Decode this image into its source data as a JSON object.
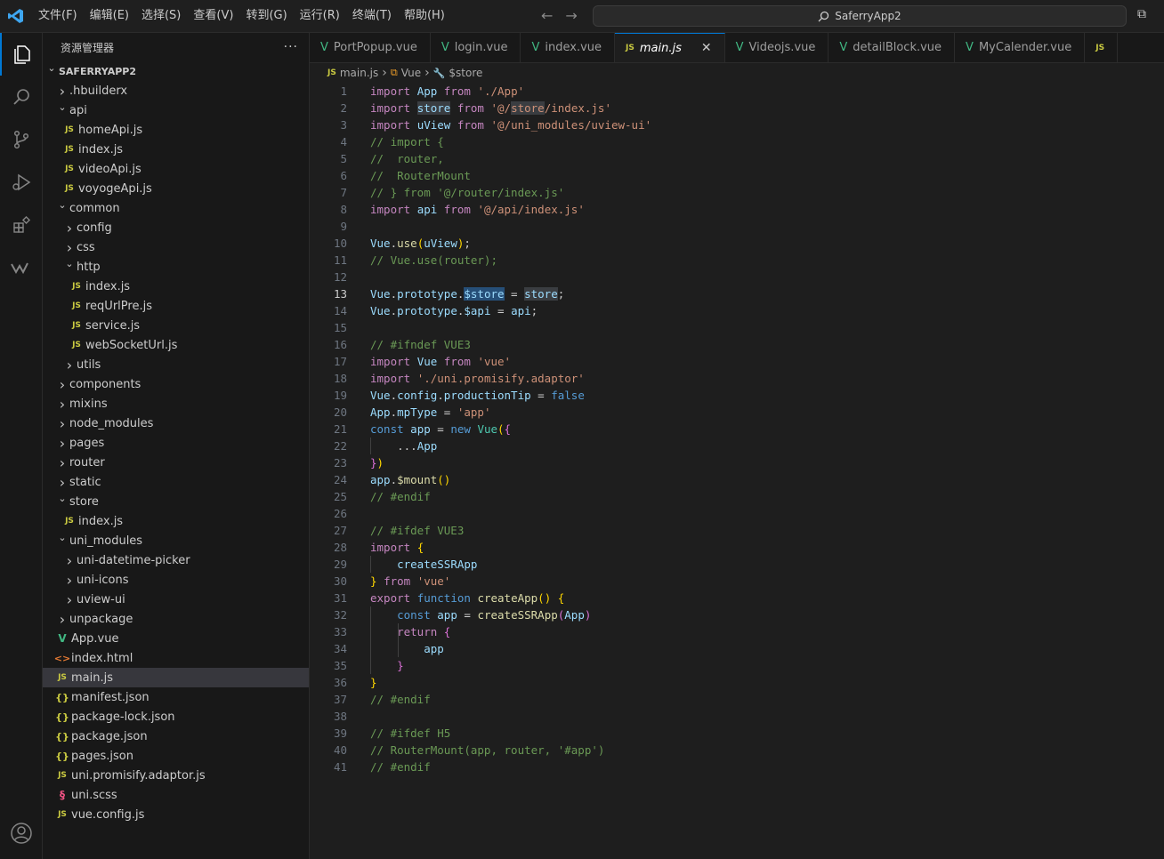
{
  "titlebar": {
    "menu": [
      "文件(F)",
      "编辑(E)",
      "选择(S)",
      "查看(V)",
      "转到(G)",
      "运行(R)",
      "终端(T)",
      "帮助(H)"
    ],
    "search_text": "SaferryApp2"
  },
  "activity_icons": [
    "explorer-icon",
    "search-icon",
    "source-control-icon",
    "run-debug-icon",
    "extensions-icon",
    "wakatime-icon",
    "account-icon"
  ],
  "sidebar": {
    "title": "资源管理器",
    "more": "···",
    "tree": [
      {
        "label": "SAFERRYAPP2",
        "depth": 0,
        "kind": "root",
        "open": true
      },
      {
        "label": ".hbuilderx",
        "depth": 1,
        "kind": "folder",
        "open": false
      },
      {
        "label": "api",
        "depth": 1,
        "kind": "folder",
        "open": true
      },
      {
        "label": "homeApi.js",
        "depth": 2,
        "kind": "js"
      },
      {
        "label": "index.js",
        "depth": 2,
        "kind": "js"
      },
      {
        "label": "videoApi.js",
        "depth": 2,
        "kind": "js"
      },
      {
        "label": "voyogeApi.js",
        "depth": 2,
        "kind": "js"
      },
      {
        "label": "common",
        "depth": 1,
        "kind": "folder",
        "open": true
      },
      {
        "label": "config",
        "depth": 2,
        "kind": "folder",
        "open": false
      },
      {
        "label": "css",
        "depth": 2,
        "kind": "folder",
        "open": false
      },
      {
        "label": "http",
        "depth": 2,
        "kind": "folder",
        "open": true
      },
      {
        "label": "index.js",
        "depth": 3,
        "kind": "js"
      },
      {
        "label": "reqUrlPre.js",
        "depth": 3,
        "kind": "js"
      },
      {
        "label": "service.js",
        "depth": 3,
        "kind": "js"
      },
      {
        "label": "webSocketUrl.js",
        "depth": 3,
        "kind": "js"
      },
      {
        "label": "utils",
        "depth": 2,
        "kind": "folder",
        "open": false
      },
      {
        "label": "components",
        "depth": 1,
        "kind": "folder",
        "open": false
      },
      {
        "label": "mixins",
        "depth": 1,
        "kind": "folder",
        "open": false
      },
      {
        "label": "node_modules",
        "depth": 1,
        "kind": "folder",
        "open": false
      },
      {
        "label": "pages",
        "depth": 1,
        "kind": "folder",
        "open": false
      },
      {
        "label": "router",
        "depth": 1,
        "kind": "folder",
        "open": false
      },
      {
        "label": "static",
        "depth": 1,
        "kind": "folder",
        "open": false
      },
      {
        "label": "store",
        "depth": 1,
        "kind": "folder",
        "open": true
      },
      {
        "label": "index.js",
        "depth": 2,
        "kind": "js"
      },
      {
        "label": "uni_modules",
        "depth": 1,
        "kind": "folder",
        "open": true
      },
      {
        "label": "uni-datetime-picker",
        "depth": 2,
        "kind": "folder",
        "open": false
      },
      {
        "label": "uni-icons",
        "depth": 2,
        "kind": "folder",
        "open": false
      },
      {
        "label": "uview-ui",
        "depth": 2,
        "kind": "folder",
        "open": false
      },
      {
        "label": "unpackage",
        "depth": 1,
        "kind": "folder",
        "open": false
      },
      {
        "label": "App.vue",
        "depth": 1,
        "kind": "vue"
      },
      {
        "label": "index.html",
        "depth": 1,
        "kind": "html"
      },
      {
        "label": "main.js",
        "depth": 1,
        "kind": "js",
        "selected": true
      },
      {
        "label": "manifest.json",
        "depth": 1,
        "kind": "json"
      },
      {
        "label": "package-lock.json",
        "depth": 1,
        "kind": "json"
      },
      {
        "label": "package.json",
        "depth": 1,
        "kind": "json"
      },
      {
        "label": "pages.json",
        "depth": 1,
        "kind": "json"
      },
      {
        "label": "uni.promisify.adaptor.js",
        "depth": 1,
        "kind": "js"
      },
      {
        "label": "uni.scss",
        "depth": 1,
        "kind": "scss"
      },
      {
        "label": "vue.config.js",
        "depth": 1,
        "kind": "js"
      }
    ]
  },
  "tabs": [
    {
      "label": "PortPopup.vue",
      "kind": "vue"
    },
    {
      "label": "login.vue",
      "kind": "vue"
    },
    {
      "label": "index.vue",
      "kind": "vue"
    },
    {
      "label": "main.js",
      "kind": "js",
      "active": true
    },
    {
      "label": "Videojs.vue",
      "kind": "vue"
    },
    {
      "label": "detailBlock.vue",
      "kind": "vue"
    },
    {
      "label": "MyCalender.vue",
      "kind": "vue"
    },
    {
      "label": "",
      "kind": "js"
    }
  ],
  "breadcrumb": [
    "main.js",
    "Vue",
    "$store"
  ],
  "editor": {
    "current_line": 13,
    "lines": [
      [
        [
          "kw",
          "import"
        ],
        [
          "t",
          " "
        ],
        [
          "id",
          "App"
        ],
        [
          "t",
          " "
        ],
        [
          "kw",
          "from"
        ],
        [
          "t",
          " "
        ],
        [
          "str",
          "'./App'"
        ]
      ],
      [
        [
          "kw",
          "import"
        ],
        [
          "t",
          " "
        ],
        [
          "id hl",
          "store"
        ],
        [
          "t",
          " "
        ],
        [
          "kw",
          "from"
        ],
        [
          "t",
          " "
        ],
        [
          "str",
          "'@/"
        ],
        [
          "str hl",
          "store"
        ],
        [
          "str",
          "/index.js'"
        ]
      ],
      [
        [
          "kw",
          "import"
        ],
        [
          "t",
          " "
        ],
        [
          "id",
          "uView"
        ],
        [
          "t",
          " "
        ],
        [
          "kw",
          "from"
        ],
        [
          "t",
          " "
        ],
        [
          "str",
          "'@/uni_modules/uview-ui'"
        ]
      ],
      [
        [
          "cm",
          "// import {"
        ]
      ],
      [
        [
          "cm",
          "//  router,"
        ]
      ],
      [
        [
          "cm",
          "//  RouterMount"
        ]
      ],
      [
        [
          "cm",
          "// } from '@/router/index.js'"
        ]
      ],
      [
        [
          "kw",
          "import"
        ],
        [
          "t",
          " "
        ],
        [
          "id",
          "api"
        ],
        [
          "t",
          " "
        ],
        [
          "kw",
          "from"
        ],
        [
          "t",
          " "
        ],
        [
          "str",
          "'@/api/index.js'"
        ]
      ],
      [],
      [
        [
          "id",
          "Vue"
        ],
        [
          "t",
          "."
        ],
        [
          "fn",
          "use"
        ],
        [
          "br1",
          "("
        ],
        [
          "id",
          "uView"
        ],
        [
          "br1",
          ")"
        ],
        [
          "t",
          ";"
        ]
      ],
      [
        [
          "cm",
          "// Vue.use(router);"
        ]
      ],
      [],
      [
        [
          "id",
          "Vue"
        ],
        [
          "t",
          "."
        ],
        [
          "id",
          "prototype"
        ],
        [
          "t",
          "."
        ],
        [
          "id hl2",
          "$store"
        ],
        [
          "t",
          " = "
        ],
        [
          "id hl",
          "store"
        ],
        [
          "t",
          ";"
        ]
      ],
      [
        [
          "id",
          "Vue"
        ],
        [
          "t",
          "."
        ],
        [
          "id",
          "prototype"
        ],
        [
          "t",
          "."
        ],
        [
          "id",
          "$api"
        ],
        [
          "t",
          " = "
        ],
        [
          "id",
          "api"
        ],
        [
          "t",
          ";"
        ]
      ],
      [],
      [
        [
          "cm",
          "// #ifndef VUE3"
        ]
      ],
      [
        [
          "kw",
          "import"
        ],
        [
          "t",
          " "
        ],
        [
          "id",
          "Vue"
        ],
        [
          "t",
          " "
        ],
        [
          "kw",
          "from"
        ],
        [
          "t",
          " "
        ],
        [
          "str",
          "'vue'"
        ]
      ],
      [
        [
          "kw",
          "import"
        ],
        [
          "t",
          " "
        ],
        [
          "str",
          "'./uni.promisify.adaptor'"
        ]
      ],
      [
        [
          "id",
          "Vue"
        ],
        [
          "t",
          "."
        ],
        [
          "id",
          "config"
        ],
        [
          "t",
          "."
        ],
        [
          "id",
          "productionTip"
        ],
        [
          "t",
          " = "
        ],
        [
          "kb",
          "false"
        ]
      ],
      [
        [
          "id",
          "App"
        ],
        [
          "t",
          "."
        ],
        [
          "id",
          "mpType"
        ],
        [
          "t",
          " = "
        ],
        [
          "str",
          "'app'"
        ]
      ],
      [
        [
          "kb",
          "const"
        ],
        [
          "t",
          " "
        ],
        [
          "id",
          "app"
        ],
        [
          "t",
          " = "
        ],
        [
          "kb",
          "new"
        ],
        [
          "t",
          " "
        ],
        [
          "cls",
          "Vue"
        ],
        [
          "br1",
          "("
        ],
        [
          "br2",
          "{"
        ]
      ],
      [
        [
          "t",
          "    ..."
        ],
        [
          "id",
          "App"
        ]
      ],
      [
        [
          "br2",
          "}"
        ],
        [
          "br1",
          ")"
        ]
      ],
      [
        [
          "id",
          "app"
        ],
        [
          "t",
          "."
        ],
        [
          "fn",
          "$mount"
        ],
        [
          "br1",
          "()"
        ]
      ],
      [
        [
          "cm",
          "// #endif"
        ]
      ],
      [],
      [
        [
          "cm",
          "// #ifdef VUE3"
        ]
      ],
      [
        [
          "kw",
          "import"
        ],
        [
          "t",
          " "
        ],
        [
          "br1",
          "{"
        ]
      ],
      [
        [
          "t",
          "    "
        ],
        [
          "id",
          "createSSRApp"
        ]
      ],
      [
        [
          "br1",
          "}"
        ],
        [
          "t",
          " "
        ],
        [
          "kw",
          "from"
        ],
        [
          "t",
          " "
        ],
        [
          "str",
          "'vue'"
        ]
      ],
      [
        [
          "kw",
          "export"
        ],
        [
          "t",
          " "
        ],
        [
          "kb",
          "function"
        ],
        [
          "t",
          " "
        ],
        [
          "fn",
          "createApp"
        ],
        [
          "br1",
          "()"
        ],
        [
          "t",
          " "
        ],
        [
          "br1",
          "{"
        ]
      ],
      [
        [
          "t",
          "    "
        ],
        [
          "kb",
          "const"
        ],
        [
          "t",
          " "
        ],
        [
          "id",
          "app"
        ],
        [
          "t",
          " = "
        ],
        [
          "fn",
          "createSSRApp"
        ],
        [
          "br2",
          "("
        ],
        [
          "id",
          "App"
        ],
        [
          "br2",
          ")"
        ]
      ],
      [
        [
          "t",
          "    "
        ],
        [
          "kw",
          "return"
        ],
        [
          "t",
          " "
        ],
        [
          "br2",
          "{"
        ]
      ],
      [
        [
          "t",
          "        "
        ],
        [
          "id",
          "app"
        ]
      ],
      [
        [
          "t",
          "    "
        ],
        [
          "br2",
          "}"
        ]
      ],
      [
        [
          "br1",
          "}"
        ]
      ],
      [
        [
          "cm",
          "// #endif"
        ]
      ],
      [],
      [
        [
          "cm",
          "// #ifdef H5"
        ]
      ],
      [
        [
          "cm",
          "// RouterMount(app, router, '#app')"
        ]
      ],
      [
        [
          "cm",
          "// #endif"
        ]
      ]
    ]
  }
}
